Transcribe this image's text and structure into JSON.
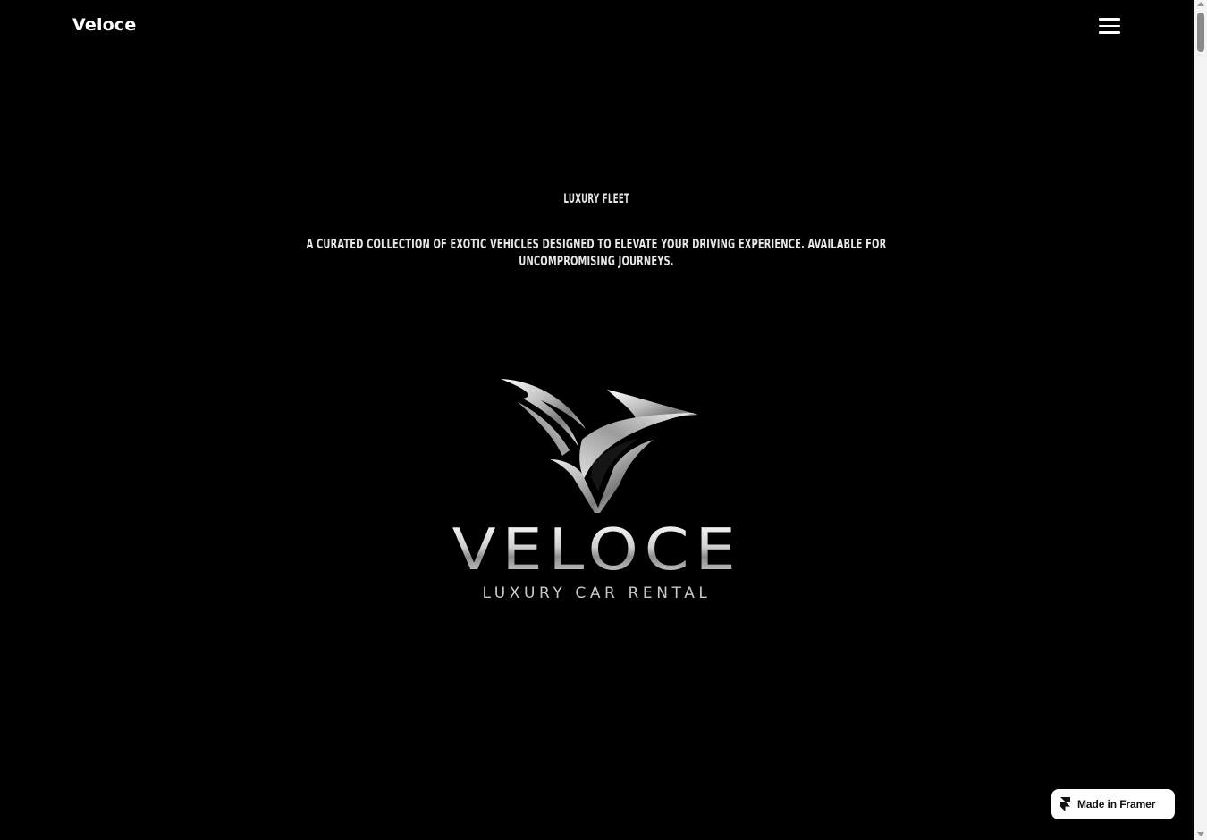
{
  "header": {
    "brand": "Veloce",
    "menu_icon": "hamburger-menu-icon"
  },
  "hero": {
    "eyebrow": "LUXURY FLEET",
    "description": "A curated collection of exotic vehicles designed to elevate your driving experience. Available for uncompromising journeys."
  },
  "logo": {
    "icon": "veloce-bird-emblem-icon",
    "wordmark": "VELOCE",
    "tagline": "LUXURY CAR RENTAL"
  },
  "badge": {
    "icon": "framer-logo-icon",
    "label": "Made in Framer"
  },
  "scrollbar": {
    "position": 0.0
  },
  "colors": {
    "background": "#000000",
    "text": "#ffffff",
    "logo_silver": "#d9d9d9"
  }
}
